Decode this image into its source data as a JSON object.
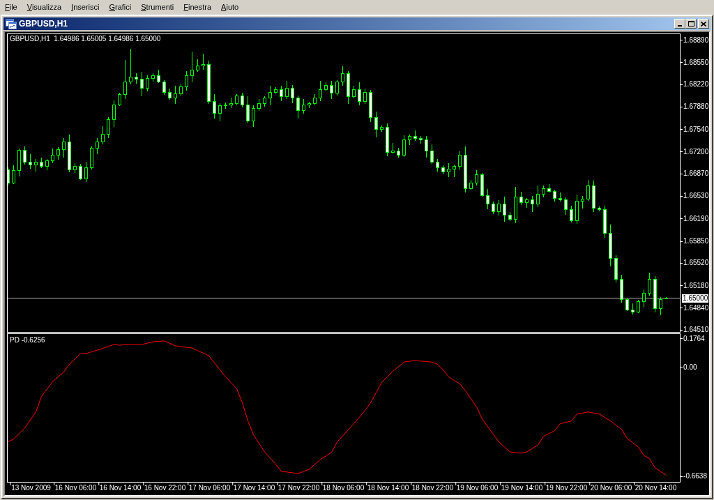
{
  "menu": [
    "File",
    "Visualizza",
    "Inserisci",
    "Grafici",
    "Strumenti",
    "Finestra",
    "Aiuto"
  ],
  "window": {
    "title": "GBPUSD,H1"
  },
  "price_chart": {
    "info": "GBPUSD,H1  1.64986 1.65005 1.64986 1.65000",
    "chart_data": {
      "type": "candlestick",
      "categories": [
        null,
        null,
        null,
        null,
        null,
        null,
        null,
        null,
        null,
        null,
        null,
        null,
        null,
        null,
        null,
        null,
        null,
        null,
        null,
        null,
        null,
        null,
        null,
        null,
        null,
        null,
        null,
        null,
        null,
        null,
        null,
        null,
        null,
        null,
        null,
        null,
        null,
        null,
        null,
        null,
        null,
        null,
        null,
        null,
        null,
        null,
        null,
        null,
        null,
        null,
        null,
        null,
        null,
        null,
        null,
        null,
        null,
        null,
        null,
        null,
        null,
        null,
        null,
        null,
        null,
        null,
        null,
        null,
        null,
        null,
        null,
        null,
        null,
        null,
        null,
        null,
        null,
        null,
        null,
        null,
        null,
        null,
        null,
        null,
        null,
        null,
        null,
        null,
        null,
        null,
        null,
        null,
        null,
        null,
        null,
        null,
        null,
        null,
        null,
        null,
        null,
        null,
        null,
        null,
        null,
        null,
        null,
        null,
        null,
        null,
        null,
        null,
        null,
        null,
        null,
        null,
        null,
        null,
        null
      ],
      "ohlc": [
        [
          1.6694,
          1.6697,
          1.6669,
          1.6674
        ],
        [
          1.6674,
          1.67,
          1.6671,
          1.6692
        ],
        [
          1.6692,
          1.6725,
          1.6683,
          1.6723
        ],
        [
          1.6723,
          1.6728,
          1.6701,
          1.6705
        ],
        [
          1.6705,
          1.6717,
          1.6695,
          1.6701
        ],
        [
          1.6701,
          1.6709,
          1.669,
          1.6705
        ],
        [
          1.6705,
          1.6711,
          1.6696,
          1.6699
        ],
        [
          1.6699,
          1.6709,
          1.6692,
          1.6707
        ],
        [
          1.6707,
          1.6725,
          1.6703,
          1.6716
        ],
        [
          1.6716,
          1.6727,
          1.6708,
          1.6724
        ],
        [
          1.6724,
          1.6741,
          1.6711,
          1.6736
        ],
        [
          1.6736,
          1.6746,
          1.6689,
          1.6694
        ],
        [
          1.6694,
          1.6703,
          1.6688,
          1.6699
        ],
        [
          1.6699,
          1.6702,
          1.6678,
          1.668
        ],
        [
          1.668,
          1.6705,
          1.6675,
          1.6697
        ],
        [
          1.6697,
          1.6728,
          1.6694,
          1.6726
        ],
        [
          1.6726,
          1.6741,
          1.6717,
          1.6736
        ],
        [
          1.6736,
          1.6759,
          1.6732,
          1.6747
        ],
        [
          1.6747,
          1.6773,
          1.6741,
          1.6769
        ],
        [
          1.6769,
          1.6798,
          1.6758,
          1.6792
        ],
        [
          1.6792,
          1.6809,
          1.6789,
          1.6807
        ],
        [
          1.6807,
          1.6859,
          1.68,
          1.6826
        ],
        [
          1.6826,
          1.6876,
          1.6822,
          1.6834
        ],
        [
          1.6834,
          1.6839,
          1.6823,
          1.6831
        ],
        [
          1.6831,
          1.6841,
          1.6804,
          1.6817
        ],
        [
          1.6817,
          1.6836,
          1.6812,
          1.6832
        ],
        [
          1.6832,
          1.6839,
          1.6826,
          1.6836
        ],
        [
          1.6836,
          1.6844,
          1.6824,
          1.6826
        ],
        [
          1.6826,
          1.6828,
          1.6806,
          1.6811
        ],
        [
          1.6811,
          1.6816,
          1.6799,
          1.6802
        ],
        [
          1.6802,
          1.682,
          1.6793,
          1.6808
        ],
        [
          1.6808,
          1.6823,
          1.6804,
          1.6819
        ],
        [
          1.6819,
          1.6842,
          1.6813,
          1.6836
        ],
        [
          1.6836,
          1.6872,
          1.6825,
          1.6844
        ],
        [
          1.6844,
          1.686,
          1.6841,
          1.6851
        ],
        [
          1.6851,
          1.6868,
          1.6844,
          1.6853
        ],
        [
          1.6853,
          1.6858,
          1.6793,
          1.6797
        ],
        [
          1.6797,
          1.6807,
          1.6771,
          1.6779
        ],
        [
          1.6779,
          1.6794,
          1.6766,
          1.679
        ],
        [
          1.679,
          1.6795,
          1.6785,
          1.6792
        ],
        [
          1.6792,
          1.6802,
          1.6786,
          1.6794
        ],
        [
          1.6794,
          1.6807,
          1.6792,
          1.6805
        ],
        [
          1.6805,
          1.681,
          1.6787,
          1.6792
        ],
        [
          1.6792,
          1.6804,
          1.6764,
          1.6767
        ],
        [
          1.6767,
          1.679,
          1.6758,
          1.6786
        ],
        [
          1.6786,
          1.68,
          1.6782,
          1.6794
        ],
        [
          1.6794,
          1.6804,
          1.6788,
          1.6802
        ],
        [
          1.6802,
          1.682,
          1.6791,
          1.6811
        ],
        [
          1.6811,
          1.6818,
          1.6808,
          1.6815
        ],
        [
          1.6815,
          1.682,
          1.6797,
          1.6804
        ],
        [
          1.6804,
          1.6827,
          1.68,
          1.6817
        ],
        [
          1.6817,
          1.6821,
          1.6794,
          1.6802
        ],
        [
          1.6802,
          1.6805,
          1.677,
          1.6783
        ],
        [
          1.6783,
          1.68,
          1.6778,
          1.6792
        ],
        [
          1.6792,
          1.6796,
          1.6786,
          1.6794
        ],
        [
          1.6794,
          1.6807,
          1.6792,
          1.6802
        ],
        [
          1.6802,
          1.6827,
          1.6797,
          1.6815
        ],
        [
          1.6815,
          1.6825,
          1.6812,
          1.6821
        ],
        [
          1.6821,
          1.6827,
          1.68,
          1.6809
        ],
        [
          1.6809,
          1.6828,
          1.6805,
          1.6826
        ],
        [
          1.6826,
          1.6849,
          1.682,
          1.6839
        ],
        [
          1.6839,
          1.6842,
          1.6793,
          1.6804
        ],
        [
          1.6804,
          1.682,
          1.6801,
          1.6815
        ],
        [
          1.6815,
          1.6825,
          1.679,
          1.6797
        ],
        [
          1.6797,
          1.6815,
          1.6793,
          1.6811
        ],
        [
          1.6811,
          1.6814,
          1.6765,
          1.6773
        ],
        [
          1.6773,
          1.6781,
          1.6742,
          1.6755
        ],
        [
          1.6755,
          1.676,
          1.675,
          1.6758
        ],
        [
          1.6758,
          1.6763,
          1.6714,
          1.672
        ],
        [
          1.672,
          1.6734,
          1.6718,
          1.6722
        ],
        [
          1.6722,
          1.6726,
          1.6711,
          1.6716
        ],
        [
          1.6716,
          1.6745,
          1.6713,
          1.6739
        ],
        [
          1.6739,
          1.6746,
          1.673,
          1.6744
        ],
        [
          1.6744,
          1.6753,
          1.6737,
          1.6741
        ],
        [
          1.6741,
          1.6744,
          1.6733,
          1.6739
        ],
        [
          1.6739,
          1.6744,
          1.6711,
          1.6722
        ],
        [
          1.6722,
          1.6732,
          1.6702,
          1.6705
        ],
        [
          1.6705,
          1.6709,
          1.669,
          1.6697
        ],
        [
          1.6697,
          1.67,
          1.6686,
          1.669
        ],
        [
          1.669,
          1.6703,
          1.6682,
          1.6695
        ],
        [
          1.6695,
          1.6701,
          1.6682,
          1.6699
        ],
        [
          1.6699,
          1.6721,
          1.6694,
          1.6716
        ],
        [
          1.6716,
          1.6728,
          1.6659,
          1.6665
        ],
        [
          1.6665,
          1.6678,
          1.6663,
          1.6674
        ],
        [
          1.6674,
          1.6692,
          1.6669,
          1.6686
        ],
        [
          1.6686,
          1.6688,
          1.6652,
          1.6655
        ],
        [
          1.6655,
          1.6664,
          1.6633,
          1.6642
        ],
        [
          1.6642,
          1.6645,
          1.6626,
          1.663
        ],
        [
          1.663,
          1.6647,
          1.6624,
          1.6642
        ],
        [
          1.6642,
          1.6652,
          1.6614,
          1.6625
        ],
        [
          1.6625,
          1.6629,
          1.6616,
          1.6619
        ],
        [
          1.6619,
          1.6667,
          1.6612,
          1.6652
        ],
        [
          1.6652,
          1.666,
          1.664,
          1.6644
        ],
        [
          1.6644,
          1.665,
          1.6636,
          1.6648
        ],
        [
          1.6648,
          1.6653,
          1.6629,
          1.6642
        ],
        [
          1.6642,
          1.6669,
          1.6637,
          1.6657
        ],
        [
          1.6657,
          1.6669,
          1.6651,
          1.6665
        ],
        [
          1.6665,
          1.6671,
          1.6659,
          1.6661
        ],
        [
          1.6661,
          1.6663,
          1.6645,
          1.665
        ],
        [
          1.665,
          1.6659,
          1.6645,
          1.6648
        ],
        [
          1.6648,
          1.6651,
          1.6625,
          1.6634
        ],
        [
          1.6634,
          1.6639,
          1.6613,
          1.6617
        ],
        [
          1.6617,
          1.6656,
          1.6611,
          1.6646
        ],
        [
          1.6646,
          1.6653,
          1.6635,
          1.6649
        ],
        [
          1.6649,
          1.6678,
          1.6646,
          1.6669
        ],
        [
          1.6669,
          1.6677,
          1.6629,
          1.6636
        ],
        [
          1.6636,
          1.6638,
          1.663,
          1.6634
        ],
        [
          1.6634,
          1.6639,
          1.659,
          1.6598
        ],
        [
          1.6598,
          1.661,
          1.6547,
          1.656
        ],
        [
          1.656,
          1.6564,
          1.6523,
          1.6528
        ],
        [
          1.6528,
          1.6534,
          1.6492,
          1.6498
        ],
        [
          1.6498,
          1.65,
          1.648,
          1.6482
        ],
        [
          1.6482,
          1.6491,
          1.6474,
          1.6479
        ],
        [
          1.6479,
          1.6497,
          1.6476,
          1.6494
        ],
        [
          1.6494,
          1.6512,
          1.6485,
          1.6507
        ],
        [
          1.6507,
          1.6538,
          1.6503,
          1.6528
        ],
        [
          1.6528,
          1.6532,
          1.6478,
          1.6484
        ],
        [
          1.6484,
          1.6501,
          1.6473,
          1.6498
        ],
        [
          1.6499,
          1.6501,
          1.6499,
          1.65
        ]
      ],
      "ylim": [
        1.6448,
        1.6898
      ],
      "yticks": [
        {
          "value": 1.6889,
          "label": "1.68890"
        },
        {
          "value": 1.6855,
          "label": "1.68550"
        },
        {
          "value": 1.6822,
          "label": "1.68220"
        },
        {
          "value": 1.6788,
          "label": "1.67880"
        },
        {
          "value": 1.6754,
          "label": "1.67540"
        },
        {
          "value": 1.672,
          "label": "1.67200"
        },
        {
          "value": 1.6687,
          "label": "1.66870"
        },
        {
          "value": 1.6653,
          "label": "1.66530"
        },
        {
          "value": 1.6619,
          "label": "1.66190"
        },
        {
          "value": 1.6585,
          "label": "1.65850"
        },
        {
          "value": 1.6552,
          "label": "1.65520"
        },
        {
          "value": 1.6518,
          "label": "1.65180"
        },
        {
          "value": 1.6484,
          "label": "1.64840"
        },
        {
          "value": 1.6451,
          "label": "1.64510"
        }
      ],
      "ref_lines": [
        {
          "axis": "y",
          "value": 1.65,
          "label": "1.65000"
        }
      ]
    }
  },
  "indicator": {
    "value": "-0.6256",
    "chart_data": {
      "type": "line",
      "categories": [
        null,
        null,
        null,
        null,
        "13 Nov 2009",
        null,
        null,
        null,
        null,
        null,
        null,
        null,
        "16 Nov 06:00",
        null,
        null,
        null,
        null,
        null,
        null,
        null,
        "16 Nov 14:00",
        null,
        null,
        null,
        null,
        null,
        null,
        null,
        "16 Nov 22:00",
        null,
        null,
        null,
        null,
        null,
        null,
        null,
        "17 Nov 06:00",
        null,
        null,
        null,
        null,
        null,
        null,
        null,
        "17 Nov 14:00",
        null,
        null,
        null,
        null,
        null,
        null,
        null,
        "17 Nov 22:00",
        null,
        null,
        null,
        null,
        null,
        null,
        null,
        "18 Nov 06:00",
        null,
        null,
        null,
        null,
        null,
        null,
        null,
        "18 Nov 14:00",
        null,
        null,
        null,
        null,
        null,
        null,
        null,
        "18 Nov 22:00",
        null,
        null,
        null,
        null,
        null,
        null,
        null,
        "19 Nov 06:00",
        null,
        null,
        null,
        null,
        null,
        null,
        null,
        "19 Nov 14:00",
        null,
        null,
        null,
        null,
        null,
        null,
        null,
        "19 Nov 22:00",
        null,
        null,
        null,
        null,
        null,
        null,
        null,
        "20 Nov 06:00",
        null,
        null,
        null,
        null,
        null,
        null,
        null,
        "20 Nov 14:00",
        null,
        null
      ],
      "series": [
        {
          "name": "PD",
          "color": "#ff0000",
          "values": [
            -0.453,
            -0.437,
            -0.403,
            -0.369,
            -0.32,
            -0.271,
            -0.176,
            -0.131,
            -0.086,
            -0.057,
            -0.027,
            0.02,
            0.053,
            0.085,
            0.085,
            0.096,
            0.106,
            0.117,
            0.129,
            0.14,
            0.136,
            0.14,
            0.14,
            0.14,
            0.14,
            0.149,
            0.157,
            0.16,
            0.162,
            0.147,
            0.132,
            0.128,
            0.123,
            0.119,
            0.103,
            0.088,
            0.072,
            0.029,
            -0.014,
            -0.057,
            -0.093,
            -0.129,
            -0.215,
            -0.326,
            -0.411,
            -0.463,
            -0.515,
            -0.553,
            -0.591,
            -0.634,
            -0.638,
            -0.642,
            -0.647,
            -0.634,
            -0.621,
            -0.591,
            -0.561,
            -0.54,
            -0.518,
            -0.454,
            -0.417,
            -0.38,
            -0.343,
            -0.303,
            -0.262,
            -0.215,
            -0.153,
            -0.091,
            -0.057,
            -0.023,
            0.005,
            0.033,
            0.038,
            0.042,
            0.039,
            0.036,
            0.033,
            0.02,
            -0.014,
            -0.057,
            -0.079,
            -0.1,
            -0.142,
            -0.192,
            -0.241,
            -0.314,
            -0.361,
            -0.407,
            -0.454,
            -0.485,
            -0.515,
            -0.519,
            -0.523,
            -0.515,
            -0.494,
            -0.472,
            -0.42,
            -0.403,
            -0.386,
            -0.343,
            -0.335,
            -0.326,
            -0.284,
            -0.278,
            -0.271,
            -0.278,
            -0.284,
            -0.305,
            -0.326,
            -0.352,
            -0.377,
            -0.433,
            -0.459,
            -0.485,
            -0.536,
            -0.556,
            -0.612,
            -0.635,
            -0.657
          ]
        }
      ],
      "ylim": [
        -0.6978,
        0.2041
      ],
      "yticks": [
        {
          "value": 0.1764,
          "label": "0.1764"
        },
        {
          "value": 0,
          "label": "0.00"
        },
        {
          "value": -0.6638,
          "label": "-0.6638"
        }
      ]
    }
  }
}
